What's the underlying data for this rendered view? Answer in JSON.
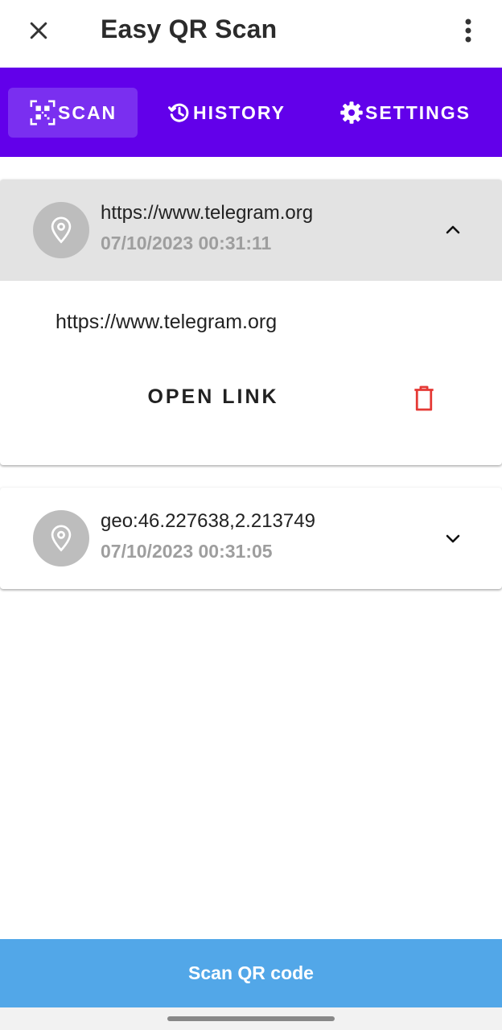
{
  "app": {
    "title": "Easy QR Scan",
    "icons": {
      "close": "close-icon",
      "more": "more-vert-icon"
    }
  },
  "tabs": [
    {
      "label": "SCAN",
      "icon": "qr-scan-icon",
      "active": true
    },
    {
      "label": "HISTORY",
      "icon": "history-icon",
      "active": false
    },
    {
      "label": "SETTINGS",
      "icon": "gear-icon",
      "active": false
    }
  ],
  "history": [
    {
      "title": "https://www.telegram.org",
      "timestamp": "07/10/2023 00:31:11",
      "icon": "location-pin-icon",
      "expanded": true,
      "detail": "https://www.telegram.org",
      "action_label": "OPEN LINK",
      "delete_icon": "trash-icon"
    },
    {
      "title": "geo:46.227638,2.213749",
      "timestamp": "07/10/2023 00:31:05",
      "icon": "location-pin-icon",
      "expanded": false
    }
  ],
  "footer": {
    "scan_button": "Scan QR code"
  },
  "colors": {
    "tab_bar": "#6200ea",
    "tab_active": "#7a2ff0",
    "scan_button": "#52a7e8",
    "delete": "#e53935",
    "expanded_header": "#e3e3e3",
    "avatar": "#bdbdbd"
  }
}
